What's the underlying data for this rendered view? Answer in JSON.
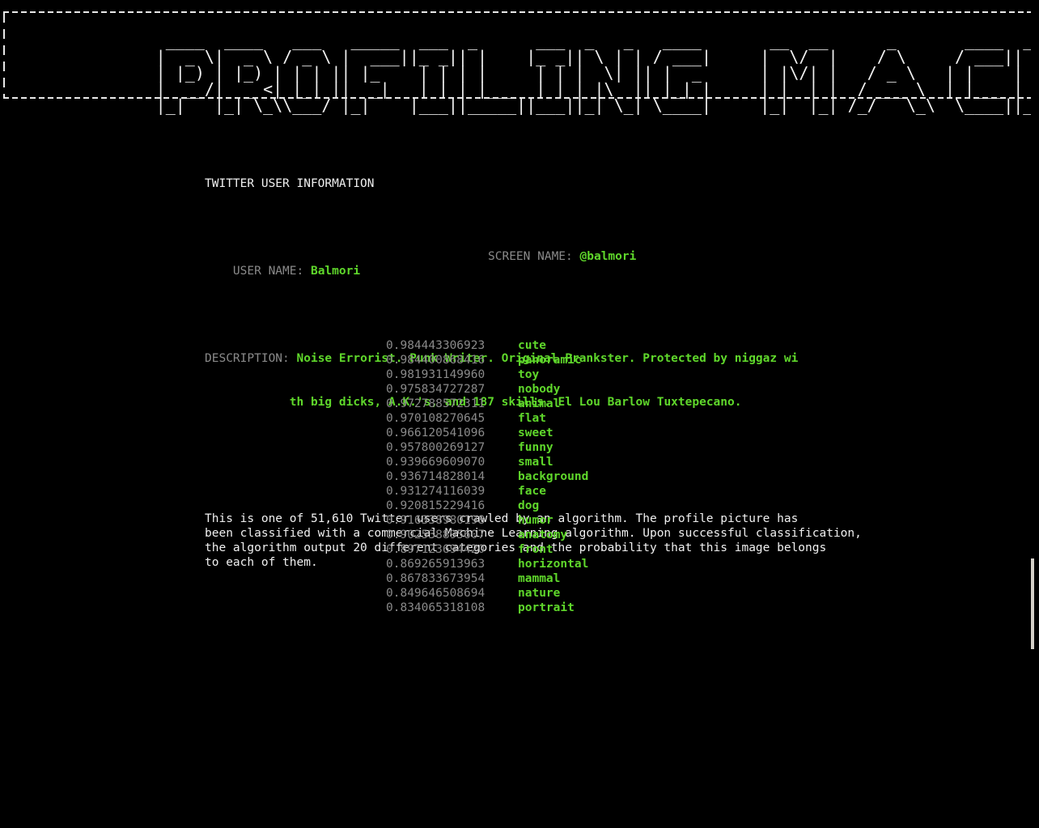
{
  "banner": {
    "title_text": "PROFILING MACHINE",
    "ascii_art": "                 ____  ____   ___   _____  ___  _      ___  _   _   ____       __  __      _       ____  _   _  ___  _   _  _____\n                |  _ \\|  _ \\ / _ \\ |  ___||_ _|| |    |_ _|| \\ | | / ___|     |  \\/  |    / \\     / ___|| | | ||_ _|| \\ | || ____|\n                | |_) | |_) | | | || |_    | | | |     | | |  \\| || |  _      | |\\/| |   / _ \\   | |    | |_| | | | |  \\| ||  _|\n                |  __/|  _ <| |_| ||  _|   | | | |___  | | | |\\  || |_| |     | |  | |  / ___ \\  | |___ |  _  | | | | |\\  || |___\n                |_|   |_| \\_\\\\___/ |_|    |___||_____||___||_| \\_| \\____|     |_|  |_| /_/   \\_\\  \\____||_| |_||___||_| \\_||_____|"
  },
  "section": {
    "title": "TWITTER USER INFORMATION"
  },
  "user": {
    "user_name_label": "USER NAME:",
    "user_name_value": "Balmori",
    "screen_name_label": "SCREEN NAME:",
    "screen_name_value": "@balmori",
    "description_label": "DESCRIPTION:",
    "description_line1": "Noise Errorist. Punk Writer. Original Prankster. Protected by niggaz wi",
    "description_line2": "th big dicks, A.K.'s, and 187 skills. El Lou Barlow Tuxtepecano."
  },
  "blurb": {
    "text": "This is one of 51,610 Twitter users crawled by an algorithm. The profile picture has\nbeen classified with a commercial Machine Learning algorithm. Upon successful classification,\nthe algorithm output 20 different categories and the probability that this image belongs\nto each of them.",
    "total_users": "51,610",
    "category_count": "20"
  },
  "predictions": [
    {
      "score": "0.984443306923",
      "label": "cute"
    },
    {
      "score": "0.984400868416",
      "label": "panoramic"
    },
    {
      "score": "0.981931149960",
      "label": "toy"
    },
    {
      "score": "0.975834727287",
      "label": "nobody"
    },
    {
      "score": "0.972788572311",
      "label": "animal"
    },
    {
      "score": "0.970108270645",
      "label": "flat"
    },
    {
      "score": "0.966120541096",
      "label": "sweet"
    },
    {
      "score": "0.957800269127",
      "label": "funny"
    },
    {
      "score": "0.939669609070",
      "label": "small"
    },
    {
      "score": "0.936714828014",
      "label": "background"
    },
    {
      "score": "0.931274116039",
      "label": "face"
    },
    {
      "score": "0.920815229416",
      "label": "dog"
    },
    {
      "score": "0.916338980198",
      "label": "humor"
    },
    {
      "score": "0.902538895607",
      "label": "anatomy"
    },
    {
      "score": "0.897123694420",
      "label": "front"
    },
    {
      "score": "0.869265913963",
      "label": "horizontal"
    },
    {
      "score": "0.867833673954",
      "label": "mammal"
    },
    {
      "score": "0.849646508694",
      "label": "nature"
    },
    {
      "score": "0.834065318108",
      "label": "portrait"
    }
  ],
  "colors": {
    "background": "#000000",
    "body_text": "#f0f0f0",
    "label_gray": "#8a8a8a",
    "accent_green": "#5fd72b",
    "border": "#e8e8e8",
    "scrollbar_thumb": "#d4d0c8"
  }
}
